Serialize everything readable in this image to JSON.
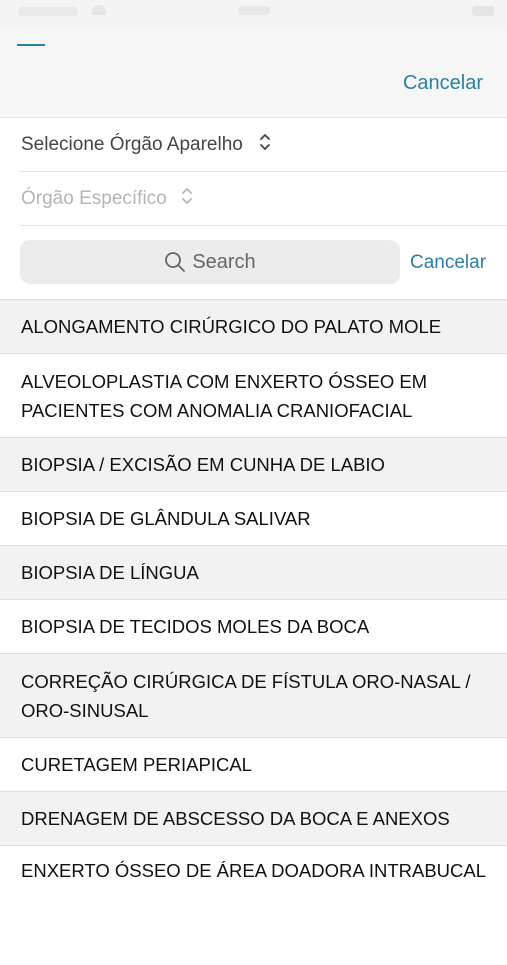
{
  "header": {
    "cancel_label": "Cancelar"
  },
  "filters": {
    "organ_system": "Selecione Órgão Aparelho",
    "specific_organ": "Órgão Específico"
  },
  "search": {
    "placeholder": "Search",
    "cancel_label": "Cancelar"
  },
  "procedures": [
    "ALONGAMENTO CIRÚRGICO DO PALATO MOLE",
    "ALVEOLOPLASTIA COM ENXERTO ÓSSEO EM PACIENTES COM ANOMALIA CRANIOFACIAL",
    "BIOPSIA / EXCISÃO EM CUNHA DE LABIO",
    "BIOPSIA DE GLÂNDULA SALIVAR",
    "BIOPSIA DE LÍNGUA",
    "BIOPSIA DE TECIDOS MOLES DA BOCA",
    "CORREÇÃO CIRÚRGICA DE FÍSTULA ORO-NASAL / ORO-SINUSAL",
    "CURETAGEM PERIAPICAL",
    "DRENAGEM DE ABSCESSO DA BOCA E ANEXOS",
    "ENXERTO ÓSSEO DE ÁREA DOADORA INTRABUCAL"
  ],
  "colors": {
    "accent": "#2a7fa6",
    "row_alt": "#f2f2f2"
  }
}
